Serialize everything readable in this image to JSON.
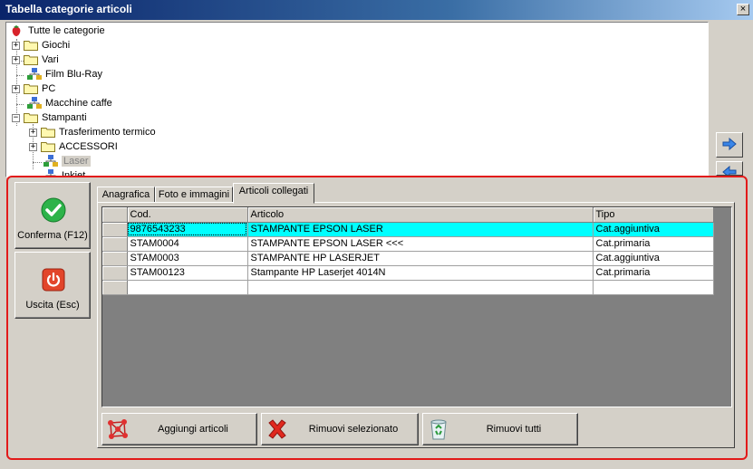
{
  "window": {
    "title": "Tabella categorie articoli",
    "close_label": "×"
  },
  "tree": {
    "root": "Tutte le categorie",
    "items": [
      {
        "label": "Giochi",
        "type": "folder",
        "expander": "+"
      },
      {
        "label": "Vari",
        "type": "folder",
        "expander": "+"
      },
      {
        "label": "Film Blu-Ray",
        "type": "leaf"
      },
      {
        "label": "PC",
        "type": "folder",
        "expander": "+"
      },
      {
        "label": "Macchine caffe",
        "type": "leaf"
      },
      {
        "label": "Stampanti",
        "type": "folder",
        "expander": "−"
      },
      {
        "label": "Trasferimento termico",
        "type": "folder",
        "expander": "+"
      },
      {
        "label": "ACCESSORI",
        "type": "folder",
        "expander": "+"
      },
      {
        "label": "Laser",
        "type": "leaf",
        "selected": true
      },
      {
        "label": "Inkjet",
        "type": "leaf"
      }
    ]
  },
  "buttons": {
    "confirm": "Conferma (F12)",
    "exit": "Uscita (Esc)"
  },
  "tabs": [
    "Anagrafica",
    "Foto e immagini",
    "Articoli collegati"
  ],
  "active_tab": "Articoli collegati",
  "grid": {
    "columns": [
      "Cod.",
      "Articolo",
      "Tipo"
    ],
    "rows": [
      {
        "cod": "9876543233",
        "articolo": "STAMPANTE EPSON LASER",
        "tipo": "Cat.aggiuntiva"
      },
      {
        "cod": "STAM0004",
        "articolo": "STAMPANTE EPSON LASER <<<",
        "tipo": "Cat.primaria"
      },
      {
        "cod": "STAM0003",
        "articolo": "STAMPANTE HP LASERJET",
        "tipo": "Cat.aggiuntiva"
      },
      {
        "cod": "STAM00123",
        "articolo": "Stampante HP Laserjet 4014N",
        "tipo": "Cat.primaria"
      },
      {
        "cod": "",
        "articolo": "",
        "tipo": ""
      }
    ]
  },
  "actions": {
    "add": "Aggiungi articoli",
    "remove_selected": "Rimuovi selezionato",
    "remove_all": "Rimuovi tutti"
  },
  "colors": {
    "highlight_row": "#00ffff",
    "panel_border": "#e21a1a",
    "title_bar": "#0a246a"
  }
}
